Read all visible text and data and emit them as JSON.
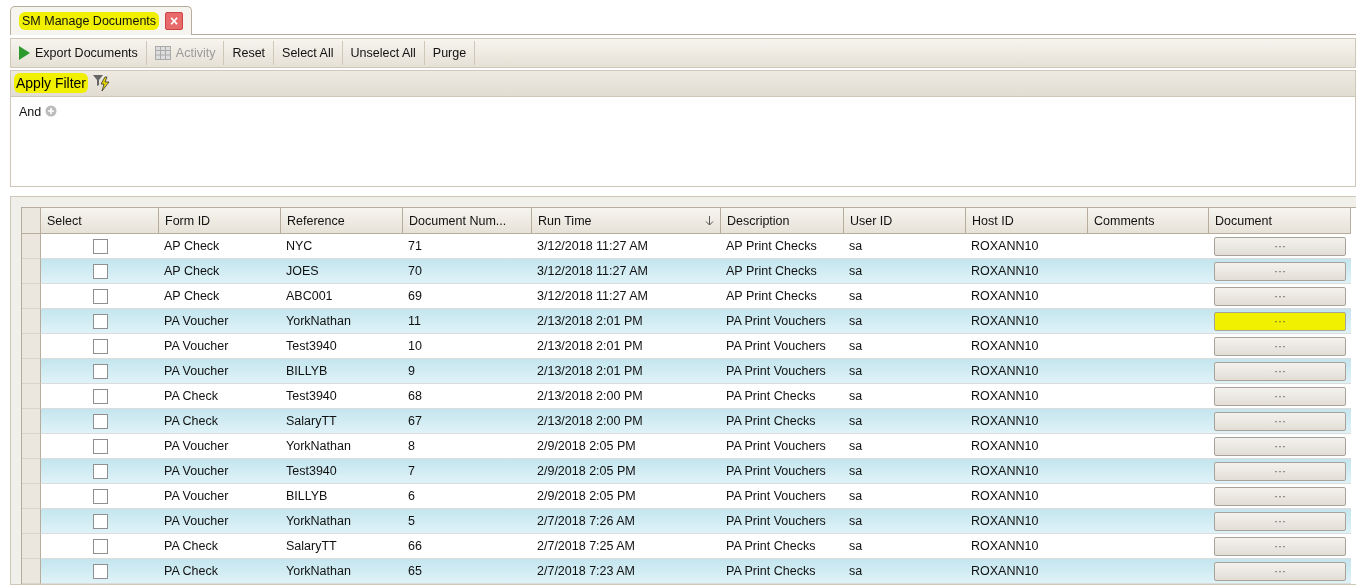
{
  "tab": {
    "title": "SM Manage Documents",
    "close": "×",
    "highlighted": true
  },
  "toolbar": [
    {
      "label": "Export Documents",
      "disabled": false
    },
    {
      "label": "Activity",
      "disabled": true
    },
    {
      "label": "Reset",
      "disabled": false
    },
    {
      "label": "Select All",
      "disabled": false
    },
    {
      "label": "Unselect All",
      "disabled": false
    },
    {
      "label": "Purge",
      "disabled": false
    }
  ],
  "filter_bar": {
    "label": "Apply Filter",
    "highlighted": true
  },
  "filter": {
    "operator": "And"
  },
  "table": {
    "columns": [
      {
        "label": "Select",
        "sorted": false
      },
      {
        "label": "Form ID",
        "sorted": false
      },
      {
        "label": "Reference",
        "sorted": false
      },
      {
        "label": "Document Num...",
        "sorted": false
      },
      {
        "label": "Run Time",
        "sorted": true
      },
      {
        "label": "Description",
        "sorted": false
      },
      {
        "label": "User ID",
        "sorted": false
      },
      {
        "label": "Host ID",
        "sorted": false
      },
      {
        "label": "Comments",
        "sorted": false
      },
      {
        "label": "Document",
        "sorted": false
      }
    ],
    "rows": [
      {
        "checked": false,
        "form_id": "AP Check",
        "reference": "NYC",
        "document_number": "71",
        "run_time": "3/12/2018 11:27 AM",
        "description": "AP Print Checks",
        "user_id": "sa",
        "host_id": "ROXANN10",
        "document": "···",
        "highlighted": false
      },
      {
        "checked": false,
        "form_id": "AP Check",
        "reference": "JOES",
        "document_number": "70",
        "run_time": "3/12/2018 11:27 AM",
        "description": "AP Print Checks",
        "user_id": "sa",
        "host_id": "ROXANN10",
        "document": "···",
        "highlighted": false
      },
      {
        "checked": false,
        "form_id": "AP Check",
        "reference": "ABC001",
        "document_number": "69",
        "run_time": "3/12/2018 11:27 AM",
        "description": "AP Print Checks",
        "user_id": "sa",
        "host_id": "ROXANN10",
        "document": "···",
        "highlighted": false
      },
      {
        "checked": false,
        "form_id": "PA Voucher",
        "reference": "YorkNathan",
        "document_number": "11",
        "run_time": "2/13/2018 2:01 PM",
        "description": "PA Print Vouchers",
        "user_id": "sa",
        "host_id": "ROXANN10",
        "document": "···",
        "highlighted": true
      },
      {
        "checked": false,
        "form_id": "PA Voucher",
        "reference": "Test3940",
        "document_number": "10",
        "run_time": "2/13/2018 2:01 PM",
        "description": "PA Print Vouchers",
        "user_id": "sa",
        "host_id": "ROXANN10",
        "document": "···",
        "highlighted": false
      },
      {
        "checked": false,
        "form_id": "PA Voucher",
        "reference": "BILLYB",
        "document_number": "9",
        "run_time": "2/13/2018 2:01 PM",
        "description": "PA Print Vouchers",
        "user_id": "sa",
        "host_id": "ROXANN10",
        "document": "···",
        "highlighted": false
      },
      {
        "checked": false,
        "form_id": "PA Check",
        "reference": "Test3940",
        "document_number": "68",
        "run_time": "2/13/2018 2:00 PM",
        "description": "PA Print Checks",
        "user_id": "sa",
        "host_id": "ROXANN10",
        "document": "···",
        "highlighted": false
      },
      {
        "checked": false,
        "form_id": "PA Check",
        "reference": "SalaryTT",
        "document_number": "67",
        "run_time": "2/13/2018 2:00 PM",
        "description": "PA Print Checks",
        "user_id": "sa",
        "host_id": "ROXANN10",
        "document": "···",
        "highlighted": false
      },
      {
        "checked": false,
        "form_id": "PA Voucher",
        "reference": "YorkNathan",
        "document_number": "8",
        "run_time": "2/9/2018 2:05 PM",
        "description": "PA Print Vouchers",
        "user_id": "sa",
        "host_id": "ROXANN10",
        "document": "···",
        "highlighted": false
      },
      {
        "checked": false,
        "form_id": "PA Voucher",
        "reference": "Test3940",
        "document_number": "7",
        "run_time": "2/9/2018 2:05 PM",
        "description": "PA Print Vouchers",
        "user_id": "sa",
        "host_id": "ROXANN10",
        "document": "···",
        "highlighted": false
      },
      {
        "checked": false,
        "form_id": "PA Voucher",
        "reference": "BILLYB",
        "document_number": "6",
        "run_time": "2/9/2018 2:05 PM",
        "description": "PA Print Vouchers",
        "user_id": "sa",
        "host_id": "ROXANN10",
        "document": "···",
        "highlighted": false
      },
      {
        "checked": false,
        "form_id": "PA Voucher",
        "reference": "YorkNathan",
        "document_number": "5",
        "run_time": "2/7/2018 7:26 AM",
        "description": "PA Print Vouchers",
        "user_id": "sa",
        "host_id": "ROXANN10",
        "document": "···",
        "highlighted": false
      },
      {
        "checked": false,
        "form_id": "PA Check",
        "reference": "SalaryTT",
        "document_number": "66",
        "run_time": "2/7/2018 7:25 AM",
        "description": "PA Print Checks",
        "user_id": "sa",
        "host_id": "ROXANN10",
        "document": "···",
        "highlighted": false
      },
      {
        "checked": false,
        "form_id": "PA Check",
        "reference": "YorkNathan",
        "document_number": "65",
        "run_time": "2/7/2018 7:23 AM",
        "description": "PA Print Checks",
        "user_id": "sa",
        "host_id": "ROXANN10",
        "document": "···",
        "highlighted": false
      }
    ]
  }
}
